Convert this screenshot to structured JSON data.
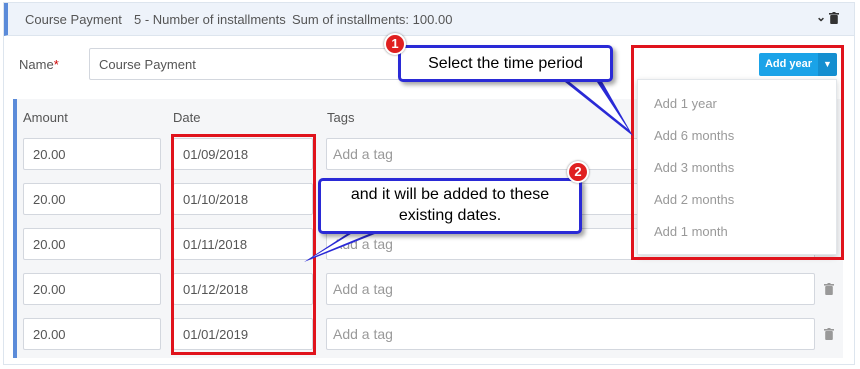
{
  "header": {
    "title": "Course Payment",
    "installments": "5 -  Number of installments",
    "sum": "Sum of installments:  100.00"
  },
  "name_field": {
    "label": "Name",
    "required_mark": "*",
    "value": "Course Payment"
  },
  "add_year": {
    "label": "Add year",
    "options": [
      "Add 1 year",
      "Add 6 months",
      "Add 3 months",
      "Add 2 months",
      "Add 1 month"
    ]
  },
  "table": {
    "columns": [
      "Amount",
      "Date",
      "Tags"
    ],
    "tag_placeholder": "Add a tag",
    "rows": [
      {
        "amount": "20.00",
        "date": "01/09/2018"
      },
      {
        "amount": "20.00",
        "date": "01/10/2018"
      },
      {
        "amount": "20.00",
        "date": "01/11/2018"
      },
      {
        "amount": "20.00",
        "date": "01/12/2018"
      },
      {
        "amount": "20.00",
        "date": "01/01/2019"
      }
    ]
  },
  "annotations": {
    "callout1": {
      "number": "1",
      "text": "Select the time period"
    },
    "callout2": {
      "number": "2",
      "line1": "and it will be added to these",
      "line2": "existing dates."
    }
  },
  "colors": {
    "accent": "#1aa3e8",
    "header_bar": "#5b8bd9",
    "highlight": "#e0131c",
    "callout_border": "#2a2ad6"
  },
  "icons": [
    "chevron-down-icon",
    "trash-icon",
    "caret-down-icon"
  ]
}
